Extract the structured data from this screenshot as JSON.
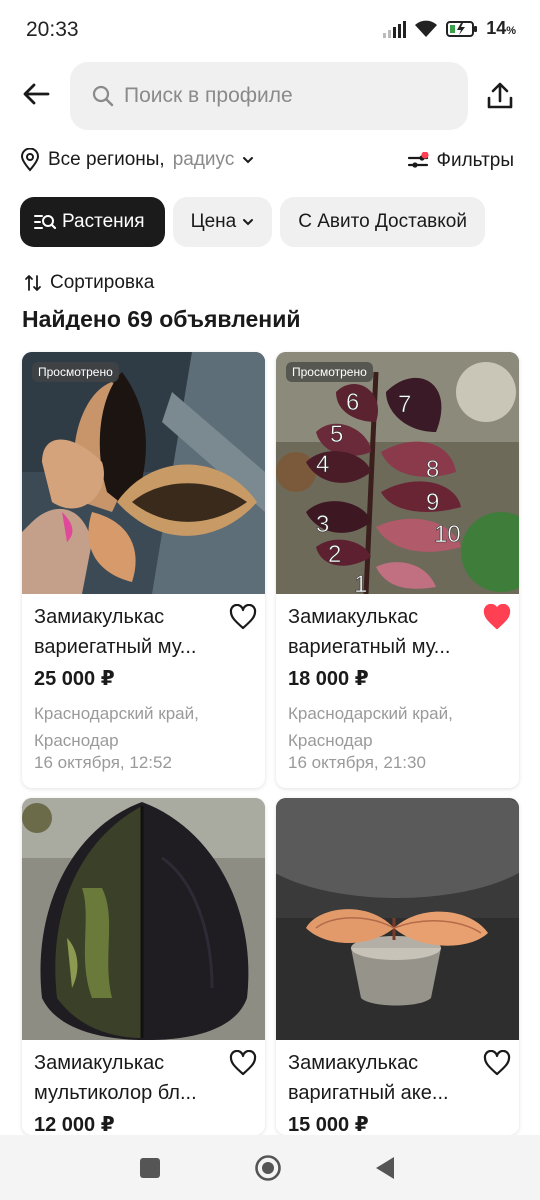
{
  "status": {
    "time": "20:33",
    "battery": "14",
    "battery_unit": "%"
  },
  "search": {
    "placeholder": "Поиск в профиле"
  },
  "region": {
    "label": "Все регионы,",
    "radius": "радиус"
  },
  "filters": {
    "label": "Фильтры"
  },
  "chips": [
    {
      "label": "Растения"
    },
    {
      "label": "Цена"
    },
    {
      "label": "С Авито Доставкой"
    }
  ],
  "sort": {
    "label": "Сортировка"
  },
  "results": {
    "label": "Найдено 69 объявлений"
  },
  "listings": [
    {
      "badge": "Просмотрено",
      "title_line1": "Замиакулькас",
      "title_line2": "вариегатный му...",
      "price": "25 000 ₽",
      "location_line1": "Краснодарский край,",
      "location_line2": "Краснодар",
      "date": "16 октября, 12:52",
      "favorited": false
    },
    {
      "badge": "Просмотрено",
      "title_line1": "Замиакулькас",
      "title_line2": "вариегатный му...",
      "price": "18 000 ₽",
      "location_line1": "Краснодарский край,",
      "location_line2": "Краснодар",
      "date": "16 октября, 21:30",
      "favorited": true,
      "photo_numbers": [
        "6",
        "7",
        "5",
        "4",
        "8",
        "9",
        "3",
        "10",
        "2",
        "1"
      ]
    },
    {
      "title_line1": "Замиакулькас",
      "title_line2": "мультиколор бл...",
      "price": "12 000 ₽",
      "favorited": false
    },
    {
      "title_line1": "Замиакулькас",
      "title_line2": "варигатный аке...",
      "price": "15 000 ₽",
      "favorited": false
    }
  ],
  "colors": {
    "accent_favorite": "#ff4053",
    "chip_active": "#1b1b1b",
    "filter_dot": "#ff4053"
  },
  "icons": [
    "back-arrow-icon",
    "search-icon",
    "share-icon",
    "location-pin-icon",
    "chevron-down-icon",
    "filters-icon",
    "catalog-search-icon",
    "sort-icon",
    "heart-icon",
    "recents-icon",
    "home-icon",
    "back-nav-icon"
  ]
}
